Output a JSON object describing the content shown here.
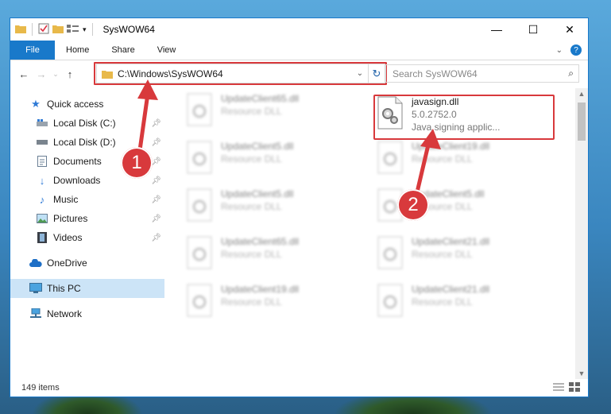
{
  "window": {
    "title": "SysWOW64"
  },
  "ribbon": {
    "file": "File",
    "home": "Home",
    "share": "Share",
    "view": "View"
  },
  "address": {
    "path": "C:\\Windows\\SysWOW64"
  },
  "search": {
    "placeholder": "Search SysWOW64"
  },
  "nav": [
    {
      "label": "Quick access"
    },
    {
      "label": "Local Disk (C:)"
    },
    {
      "label": "Local Disk (D:)"
    },
    {
      "label": "Documents"
    },
    {
      "label": "Downloads"
    },
    {
      "label": "Music"
    },
    {
      "label": "Pictures"
    },
    {
      "label": "Videos"
    },
    {
      "label": "OneDrive"
    },
    {
      "label": "This PC"
    },
    {
      "label": "Network"
    }
  ],
  "files": {
    "left": [
      {
        "name": "UpdateClient65.dll",
        "type": "Resource DLL"
      },
      {
        "name": "UpdateClient5.dll",
        "type": "Resource DLL"
      },
      {
        "name": "UpdateClient5.dll",
        "type": "Resource DLL"
      },
      {
        "name": "UpdateClient65.dll",
        "type": "Resource DLL"
      },
      {
        "name": "UpdateClient19.dll",
        "type": "Resource DLL"
      }
    ],
    "right_selected": {
      "name": "javasign.dll",
      "version": "5.0.2752.0",
      "description": "Java signing applic..."
    },
    "right": [
      {
        "name": "UpdateClient19.dll",
        "type": "Resource DLL"
      },
      {
        "name": "UpdateClient5.dll",
        "type": "Resource DLL"
      },
      {
        "name": "UpdateClient21.dll",
        "type": "Resource DLL"
      },
      {
        "name": "UpdateClient21.dll",
        "type": "Resource DLL"
      }
    ]
  },
  "status": {
    "count": "149 items"
  },
  "annotations": {
    "step1": "1",
    "step2": "2",
    "color": "#d8393c"
  }
}
